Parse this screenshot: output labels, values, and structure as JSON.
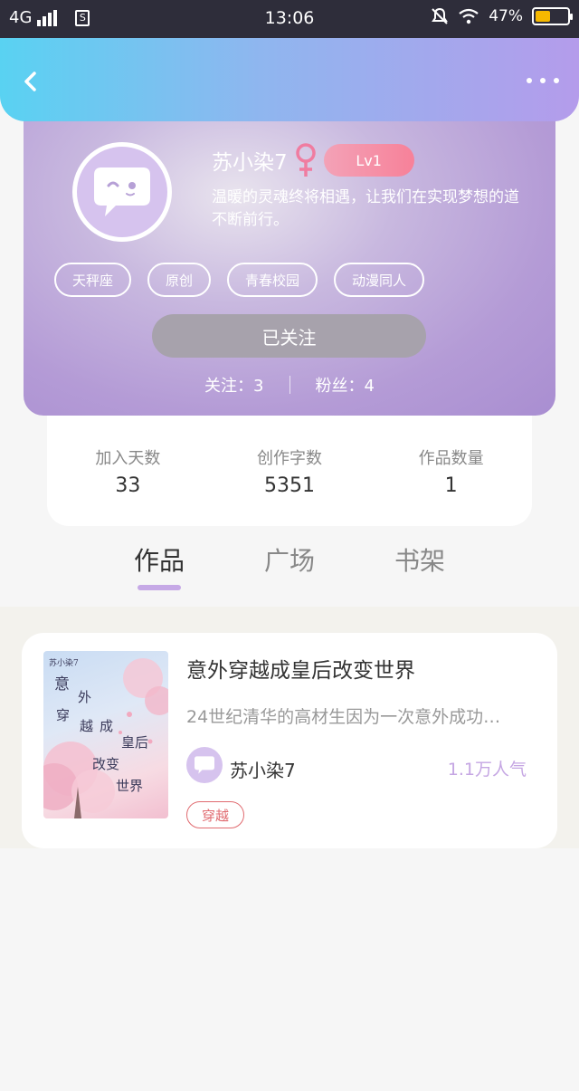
{
  "status_bar": {
    "network": "4G",
    "time": "13:06",
    "battery": "47%",
    "battery_level": 0.47
  },
  "header": {
    "back_icon": "chevron-left-icon",
    "more_icon": "more-dots-icon"
  },
  "profile": {
    "name": "苏小染7",
    "gender_icon": "female-icon",
    "level": "Lv1",
    "bio_line1": "温暖的灵魂终将相遇，让我们在实现梦想的道",
    "bio_line2": "不断前行。",
    "tags": [
      "天秤座",
      "原创",
      "青春校园",
      "动漫同人"
    ],
    "follow_button": "已关注",
    "following": "关注：3",
    "followers": "粉丝：4"
  },
  "summary": {
    "items": [
      {
        "label": "加入天数",
        "value": "33"
      },
      {
        "label": "创作字数",
        "value": "5351"
      },
      {
        "label": "作品数量",
        "value": "1"
      }
    ]
  },
  "tabs": [
    "作品",
    "广场",
    "书架"
  ],
  "works": [
    {
      "title": "意外穿越成皇后改变世界",
      "description": "24世纪清华的高材生因为一次意外成功…",
      "author": "苏小染7",
      "popularity": "1.1万人气",
      "genre": "穿越",
      "cover_author": "苏小染7",
      "cover_title_parts": [
        "意",
        "外",
        "穿",
        "越",
        "成",
        "皇后",
        "改变",
        "世界"
      ]
    }
  ],
  "colors": {
    "accent": "#c5a6e3",
    "header_start": "#59d2f2",
    "header_end": "#b49ceb",
    "genre": "#e06b70"
  }
}
